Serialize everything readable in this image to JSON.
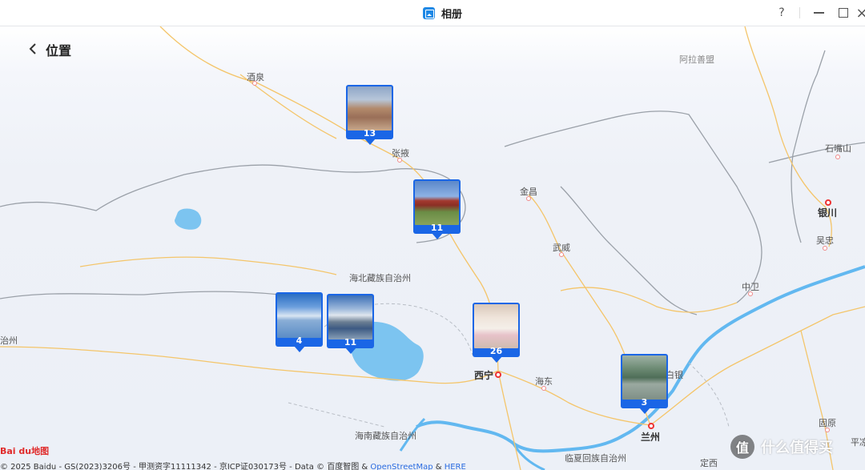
{
  "window": {
    "app_title": "相册",
    "help_symbol": "?",
    "close_symbol": "×"
  },
  "header": {
    "page_title": "位置"
  },
  "map": {
    "labels": {
      "jiuquan": "酒泉",
      "alxa": "阿拉善盟",
      "zhangye": "张掖",
      "shizuishan": "石嘴山",
      "jinchang": "金昌",
      "yinchuan": "银川",
      "wuzhong": "吴忠",
      "wuwei": "武威",
      "haibei": "海北藏族自治州",
      "zhongwei": "中卫",
      "zhou_left": "治州",
      "baiyin": "白银",
      "xining": "西宁",
      "haidong": "海东",
      "guyuan": "固原",
      "hainan": "海南藏族自治州",
      "lanzhou": "兰州",
      "pingliang": "平凉",
      "linxia": "临夏回族自治州",
      "dingxi": "定西"
    },
    "markers": [
      {
        "count": "13",
        "photo": "mountain-photo"
      },
      {
        "count": "11",
        "photo": "building-photo"
      },
      {
        "count": "4",
        "photo": "salt-lake-photo"
      },
      {
        "count": "11",
        "photo": "prayer-cairn-photo"
      },
      {
        "count": "26",
        "photo": "room-photo"
      },
      {
        "count": "3",
        "photo": "road-sign-photo"
      }
    ],
    "colors": {
      "marker_blue": "#1a66e6",
      "water": "#7cc4f0",
      "river": "#62b8f0",
      "road": "#f4c56a",
      "border": "#9aa0a8"
    }
  },
  "footer": {
    "logo": "Bai du地图",
    "copyright": "© 2025 Baidu - GS(2023)3206号 - 甲测资字11111342 - 京ICP证030173号 - Data © 百度智图 & ",
    "osm": "OpenStreetMap",
    "amp": " & ",
    "here": "HERE"
  },
  "watermark": {
    "icon_text": "值",
    "text": "什么值得买"
  }
}
